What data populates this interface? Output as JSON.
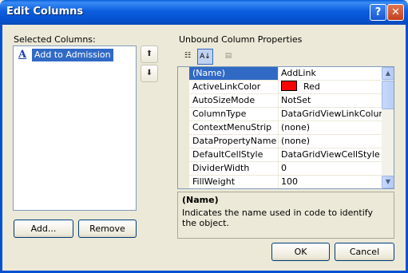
{
  "window": {
    "title": "Edit Columns",
    "help_glyph": "?",
    "close_glyph": "✕"
  },
  "left": {
    "label": "Selected Columns:",
    "items": [
      {
        "glyph": "A",
        "label": "Add to Admission"
      }
    ],
    "add_button": "Add...",
    "remove_button": "Remove",
    "move_up_glyph": "⬆",
    "move_down_glyph": "⬇"
  },
  "right": {
    "label": "Unbound Column Properties",
    "toolbar": {
      "categorized_glyph": "☷",
      "alphabetical_glyph": "A↓",
      "pages_glyph": "▤"
    },
    "properties": [
      {
        "name": "(Name)",
        "value": "AddLink",
        "selected": true
      },
      {
        "name": "ActiveLinkColor",
        "value": "Red",
        "swatch": "#ff0000"
      },
      {
        "name": "AutoSizeMode",
        "value": "NotSet"
      },
      {
        "name": "ColumnType",
        "value": "DataGridViewLinkColumn"
      },
      {
        "name": "ContextMenuStrip",
        "value": "(none)"
      },
      {
        "name": "DataPropertyName",
        "value": "(none)"
      },
      {
        "name": "DefaultCellStyle",
        "value": "DataGridViewCellStyle { }"
      },
      {
        "name": "DividerWidth",
        "value": "0"
      },
      {
        "name": "FillWeight",
        "value": "100"
      }
    ],
    "description": {
      "title": "(Name)",
      "text": "Indicates the name used in code to identify the object."
    }
  },
  "buttons": {
    "ok": "OK",
    "cancel": "Cancel"
  },
  "colors": {
    "titlebar": "#0c5ede",
    "selection": "#316ac5",
    "dialog_bg": "#ece9d8"
  }
}
